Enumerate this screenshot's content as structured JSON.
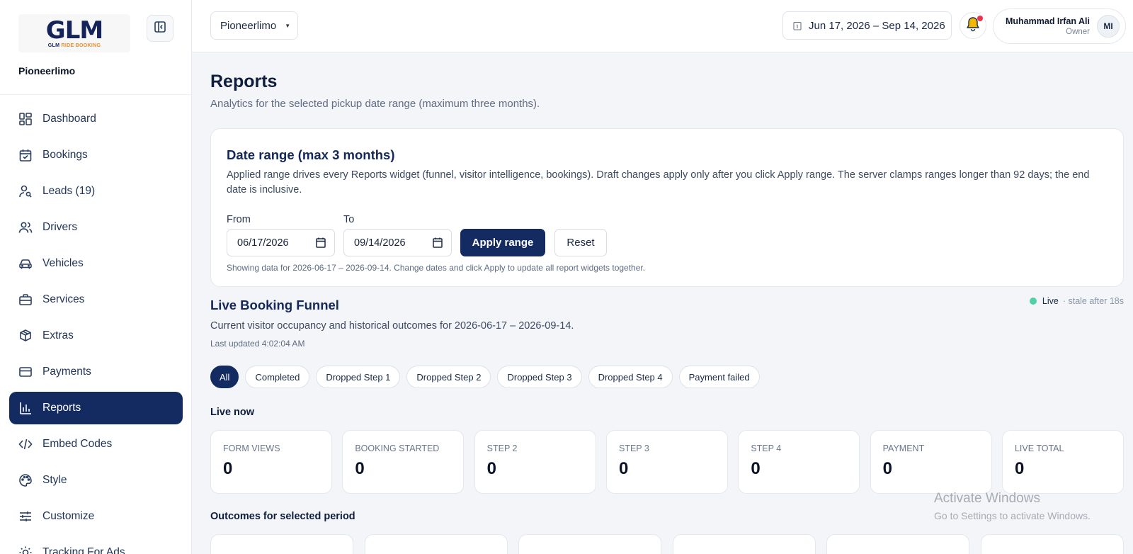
{
  "brand": {
    "logo_text": "GLM",
    "logo_subtitle_1": "GLM",
    "logo_subtitle_2": "RIDE BOOKING",
    "org_name": "Pioneerlimo",
    "accent_color": "#132b60",
    "logo_orange": "#f08a24"
  },
  "sidebar": {
    "items": [
      {
        "label": "Dashboard",
        "icon": "dashboard-icon",
        "active": false
      },
      {
        "label": "Bookings",
        "icon": "calendar-check-icon",
        "active": false
      },
      {
        "label": "Leads (19)",
        "icon": "user-search-icon",
        "active": false
      },
      {
        "label": "Drivers",
        "icon": "users-icon",
        "active": false
      },
      {
        "label": "Vehicles",
        "icon": "car-icon",
        "active": false
      },
      {
        "label": "Services",
        "icon": "briefcase-icon",
        "active": false
      },
      {
        "label": "Extras",
        "icon": "package-icon",
        "active": false
      },
      {
        "label": "Payments",
        "icon": "credit-card-icon",
        "active": false
      },
      {
        "label": "Reports",
        "icon": "bar-chart-icon",
        "active": true
      },
      {
        "label": "Embed Codes",
        "icon": "code-icon",
        "active": false
      },
      {
        "label": "Style",
        "icon": "palette-icon",
        "active": false
      },
      {
        "label": "Customize",
        "icon": "sliders-icon",
        "active": false
      },
      {
        "label": "Tracking For Ads",
        "icon": "sun-icon",
        "active": false
      }
    ]
  },
  "topbar": {
    "org_select": "Pioneerlimo",
    "date_range": "Jun 17, 2026 – Sep 14, 2026",
    "user": {
      "name": "Muhammad Irfan Ali",
      "role": "Owner",
      "initials": "MI"
    }
  },
  "page": {
    "title": "Reports",
    "subtitle": "Analytics for the selected pickup date range (maximum three months)."
  },
  "date_card": {
    "title": "Date range (max 3 months)",
    "description": "Applied range drives every Reports widget (funnel, visitor intelligence, bookings). Draft changes apply only after you click Apply range. The server clamps ranges longer than 92 days; the end date is inclusive.",
    "from_label": "From",
    "to_label": "To",
    "from_value": "06/17/2026",
    "to_value": "09/14/2026",
    "apply_label": "Apply range",
    "reset_label": "Reset",
    "note": "Showing data for 2026-06-17 – 2026-09-14. Change dates and click Apply to update all report widgets together."
  },
  "funnel": {
    "title": "Live Booking Funnel",
    "live_label": "Live",
    "stale_label": "· stale after 18s",
    "subtitle": "Current visitor occupancy and historical outcomes for 2026-06-17 – 2026-09-14.",
    "last_updated": "Last updated 4:02:04 AM",
    "filters": [
      {
        "label": "All",
        "active": true
      },
      {
        "label": "Completed",
        "active": false
      },
      {
        "label": "Dropped Step 1",
        "active": false
      },
      {
        "label": "Dropped Step 2",
        "active": false
      },
      {
        "label": "Dropped Step 3",
        "active": false
      },
      {
        "label": "Dropped Step 4",
        "active": false
      },
      {
        "label": "Payment failed",
        "active": false
      }
    ],
    "live_now_title": "Live now",
    "stats": [
      {
        "label": "Form views",
        "value": "0"
      },
      {
        "label": "Booking started",
        "value": "0"
      },
      {
        "label": "Step 2",
        "value": "0"
      },
      {
        "label": "Step 3",
        "value": "0"
      },
      {
        "label": "Step 4",
        "value": "0"
      },
      {
        "label": "Payment",
        "value": "0"
      },
      {
        "label": "Live total",
        "value": "0"
      }
    ],
    "outcomes_title": "Outcomes for selected period"
  },
  "watermark": {
    "line1": "Activate Windows",
    "line2": "Go to Settings to activate Windows."
  }
}
